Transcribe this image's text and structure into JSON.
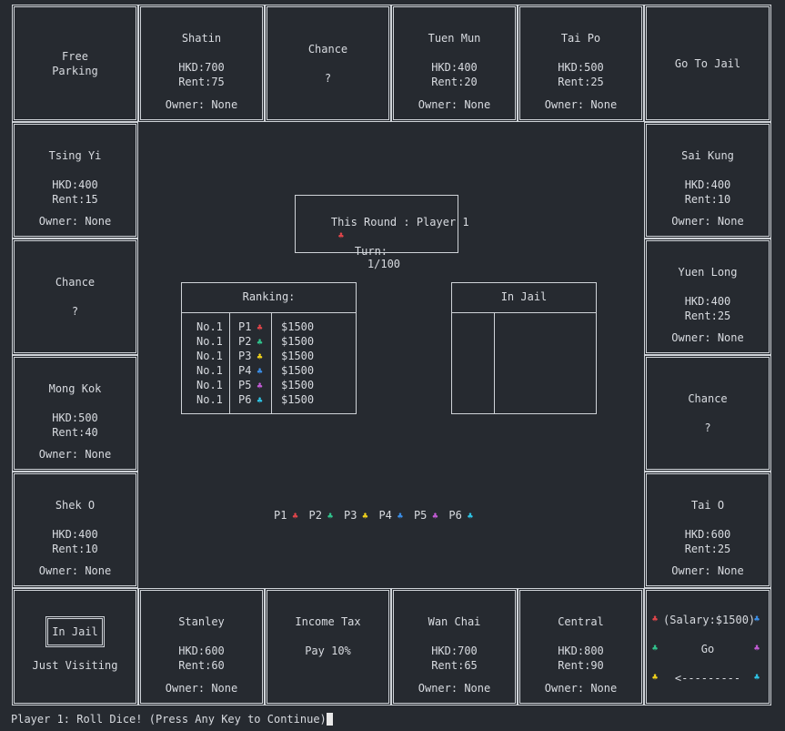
{
  "top": [
    {
      "type": "corner",
      "line1": "Free",
      "line2": "Parking"
    },
    {
      "type": "prop",
      "name": "Shatin",
      "price": "HKD:700",
      "rent": "Rent:75",
      "owner": "Owner: None"
    },
    {
      "type": "chance",
      "title": "Chance",
      "mark": "?"
    },
    {
      "type": "prop",
      "name": "Tuen Mun",
      "price": "HKD:400",
      "rent": "Rent:20",
      "owner": "Owner: None"
    },
    {
      "type": "prop",
      "name": "Tai Po",
      "price": "HKD:500",
      "rent": "Rent:25",
      "owner": "Owner: None"
    },
    {
      "type": "corner",
      "line1": "Go To Jail"
    }
  ],
  "left": [
    {
      "type": "prop",
      "name": "Tsing Yi",
      "price": "HKD:400",
      "rent": "Rent:15",
      "owner": "Owner: None"
    },
    {
      "type": "chance",
      "title": "Chance",
      "mark": "?"
    },
    {
      "type": "prop",
      "name": "Mong Kok",
      "price": "HKD:500",
      "rent": "Rent:40",
      "owner": "Owner: None"
    },
    {
      "type": "prop",
      "name": "Shek O",
      "price": "HKD:400",
      "rent": "Rent:10",
      "owner": "Owner: None"
    }
  ],
  "right": [
    {
      "type": "prop",
      "name": "Sai Kung",
      "price": "HKD:400",
      "rent": "Rent:10",
      "owner": "Owner: None"
    },
    {
      "type": "prop",
      "name": "Yuen Long",
      "price": "HKD:400",
      "rent": "Rent:25",
      "owner": "Owner: None"
    },
    {
      "type": "chance",
      "title": "Chance",
      "mark": "?"
    },
    {
      "type": "prop",
      "name": "Tai O",
      "price": "HKD:600",
      "rent": "Rent:25",
      "owner": "Owner: None"
    }
  ],
  "bottom": [
    {
      "type": "jail",
      "box": "In Jail",
      "visiting": "Just Visiting"
    },
    {
      "type": "prop",
      "name": "Stanley",
      "price": "HKD:600",
      "rent": "Rent:60",
      "owner": "Owner: None"
    },
    {
      "type": "tax",
      "title": "Income Tax",
      "sub": "Pay 10%"
    },
    {
      "type": "prop",
      "name": "Wan Chai",
      "price": "HKD:700",
      "rent": "Rent:65",
      "owner": "Owner: None"
    },
    {
      "type": "prop",
      "name": "Central",
      "price": "HKD:800",
      "rent": "Rent:90",
      "owner": "Owner: None"
    },
    {
      "type": "go",
      "salary": "(Salary:$1500)",
      "go": "Go",
      "arrow": "<---------"
    }
  ],
  "round": {
    "label": "This Round : Player 1",
    "turn_label": "Turn:",
    "turn_value": "1/100"
  },
  "ranking": {
    "title": "Ranking:",
    "rows": [
      {
        "rank": "No.1",
        "player": "P1",
        "money": "$1500",
        "color": "#e0454a"
      },
      {
        "rank": "No.1",
        "player": "P2",
        "money": "$1500",
        "color": "#31c48d"
      },
      {
        "rank": "No.1",
        "player": "P3",
        "money": "$1500",
        "color": "#f1d21b"
      },
      {
        "rank": "No.1",
        "player": "P4",
        "money": "$1500",
        "color": "#3b8fe8"
      },
      {
        "rank": "No.1",
        "player": "P5",
        "money": "$1500",
        "color": "#c35bd6"
      },
      {
        "rank": "No.1",
        "player": "P6",
        "money": "$1500",
        "color": "#2ec4e6"
      }
    ]
  },
  "in_jail": {
    "title": "In Jail"
  },
  "players": [
    {
      "label": "P1",
      "color": "#e0454a"
    },
    {
      "label": "P2",
      "color": "#31c48d"
    },
    {
      "label": "P3",
      "color": "#f1d21b"
    },
    {
      "label": "P4",
      "color": "#3b8fe8"
    },
    {
      "label": "P5",
      "color": "#c35bd6"
    },
    {
      "label": "P6",
      "color": "#2ec4e6"
    }
  ],
  "token_glyph": "♣",
  "status": "Player 1: Roll Dice! (Press Any Key to Continue)"
}
